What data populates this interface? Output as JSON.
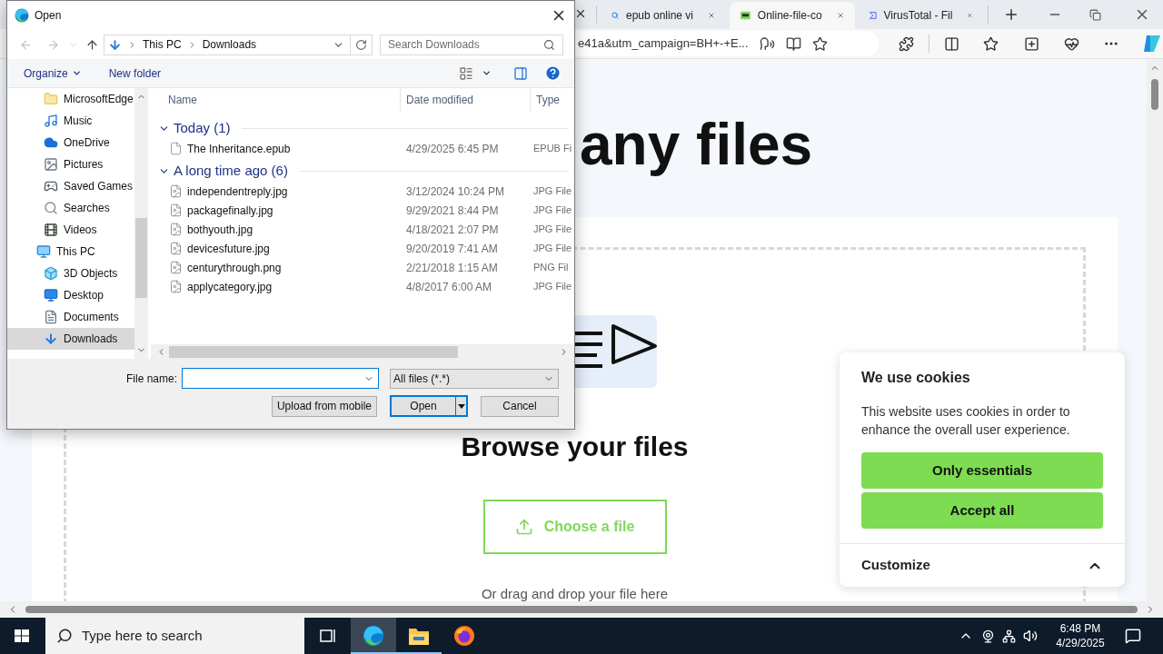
{
  "browser": {
    "tabs": [
      {
        "title": "epub online vi",
        "kind": "search",
        "selected": false
      },
      {
        "title": "Online-file-co",
        "kind": "ofc",
        "selected": true
      },
      {
        "title": "VirusTotal - Fil",
        "kind": "virustotal",
        "selected": false
      }
    ],
    "address": "e41a&utm_campaign=BH+-+E...",
    "page": {
      "heading": "any files",
      "browse_title": "Browse your files",
      "choose_button": "Choose a file",
      "drag_hint": "Or drag and drop your file here"
    },
    "cookie_banner": {
      "title": "We use cookies",
      "text": "This website uses cookies in order to enhance the overall user experience.",
      "buttons": [
        "Only essentials",
        "Accept all"
      ],
      "customize": "Customize"
    }
  },
  "dialog": {
    "title": "Open",
    "path": [
      "This PC",
      "Downloads"
    ],
    "search_placeholder": "Search Downloads",
    "organize": "Organize",
    "new_folder": "New folder",
    "sidebar": {
      "folders": [
        {
          "label": "MicrosoftEdge",
          "kind": "folder",
          "selected": false
        },
        {
          "label": "Music",
          "kind": "music",
          "selected": false
        },
        {
          "label": "OneDrive",
          "kind": "onedrive",
          "selected": false
        },
        {
          "label": "Pictures",
          "kind": "pictures",
          "selected": false
        },
        {
          "label": "Saved Games",
          "kind": "games",
          "selected": false
        },
        {
          "label": "Searches",
          "kind": "searches",
          "selected": false
        },
        {
          "label": "Videos",
          "kind": "videos",
          "selected": false
        }
      ],
      "this_pc": {
        "label": "This PC",
        "kind": "pc",
        "selected": false,
        "children": [
          {
            "label": "3D Objects",
            "kind": "objects",
            "selected": false
          },
          {
            "label": "Desktop",
            "kind": "desktop",
            "selected": false
          },
          {
            "label": "Documents",
            "kind": "documents",
            "selected": false
          },
          {
            "label": "Downloads",
            "kind": "downloads",
            "selected": true
          }
        ]
      }
    },
    "columns": [
      "Name",
      "Date modified",
      "Type"
    ],
    "groups": [
      {
        "label": "Today (1)",
        "expanded": true,
        "files": [
          {
            "name": "The Inheritance.epub",
            "date": "4/29/2025 6:45 PM",
            "type": "EPUB Fi",
            "kind": "document"
          }
        ]
      },
      {
        "label": "A long time ago (6)",
        "expanded": true,
        "files": [
          {
            "name": "independentreply.jpg",
            "date": "3/12/2024 10:24 PM",
            "type": "JPG File",
            "kind": "image"
          },
          {
            "name": "packagefinally.jpg",
            "date": "9/29/2021 8:44 PM",
            "type": "JPG File",
            "kind": "image"
          },
          {
            "name": "bothyouth.jpg",
            "date": "4/18/2021 2:07 PM",
            "type": "JPG File",
            "kind": "image"
          },
          {
            "name": "devicesfuture.jpg",
            "date": "9/20/2019 7:41 AM",
            "type": "JPG File",
            "kind": "image"
          },
          {
            "name": "centurythrough.png",
            "date": "2/21/2018 1:15 AM",
            "type": "PNG Fil",
            "kind": "image"
          },
          {
            "name": "applycategory.jpg",
            "date": "4/8/2017 6:00 AM",
            "type": "JPG File",
            "kind": "image"
          }
        ]
      }
    ],
    "file_name_label": "File name:",
    "filter": "All files (*.*)",
    "buttons": [
      {
        "label": "Upload from mobile",
        "kind": "plain"
      },
      {
        "label": "Open",
        "kind": "split"
      },
      {
        "label": "Cancel",
        "kind": "plain"
      }
    ]
  },
  "taskbar": {
    "search_placeholder": "Type here to search",
    "apps": [
      {
        "kind": "taskview",
        "selected": false,
        "running": false
      },
      {
        "kind": "edge",
        "selected": true,
        "running": true
      },
      {
        "kind": "explorer",
        "selected": false,
        "running": true
      },
      {
        "kind": "firefox",
        "selected": false,
        "running": false
      }
    ],
    "time": "6:48 PM",
    "date": "4/29/2025"
  }
}
